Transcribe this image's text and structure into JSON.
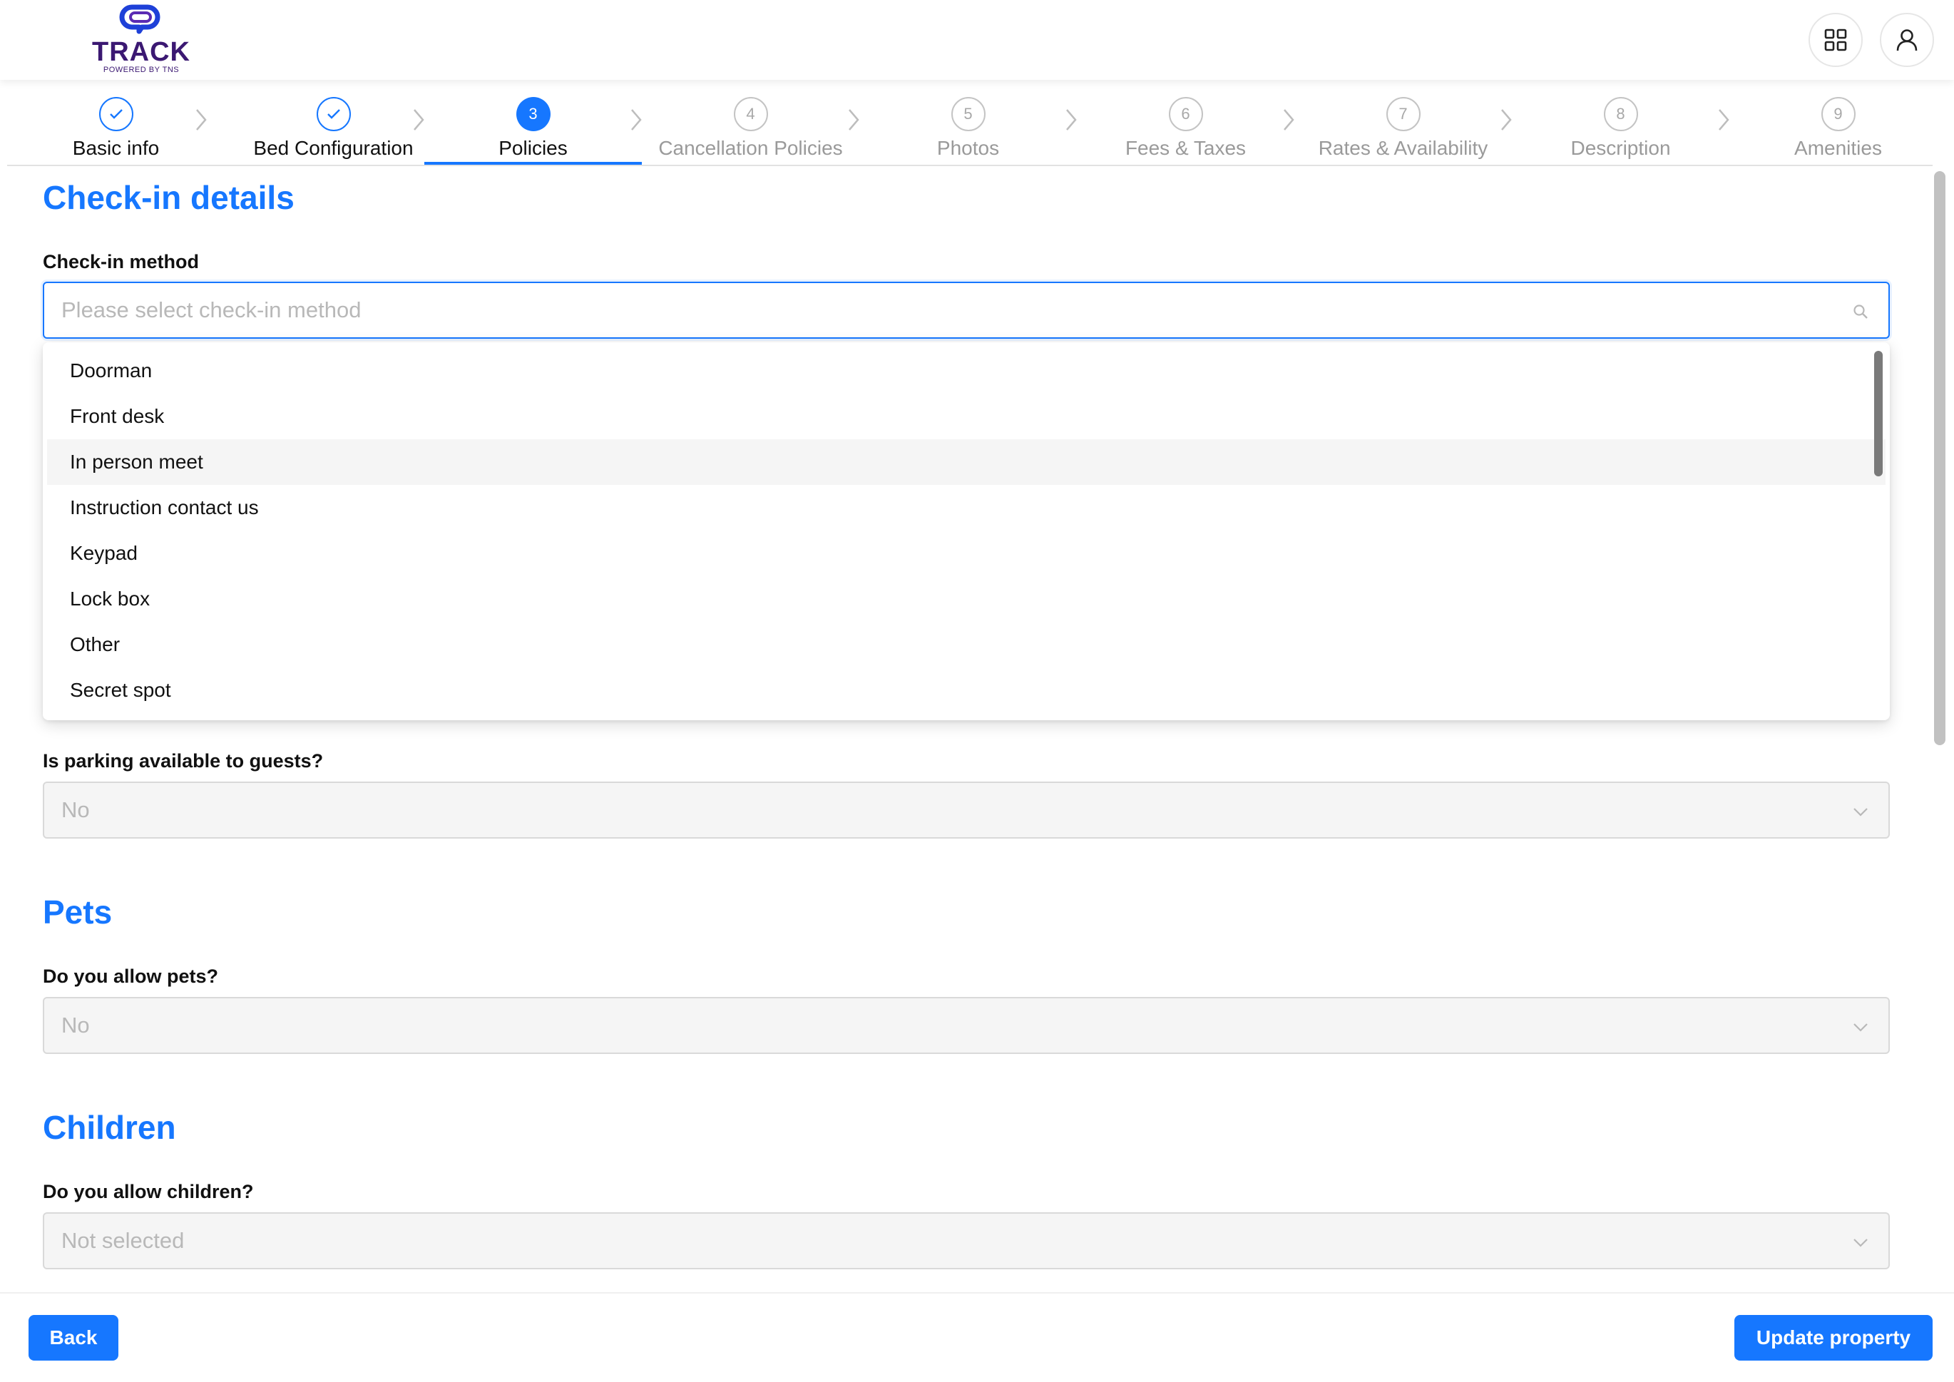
{
  "brand": {
    "name": "TRACK",
    "tagline": "POWERED BY TNS"
  },
  "header": {
    "apps_icon": "grid-icon",
    "user_icon": "user-icon"
  },
  "steps": [
    {
      "label": "Basic info",
      "marker": "",
      "state": "done"
    },
    {
      "label": "Bed Configuration",
      "marker": "",
      "state": "done"
    },
    {
      "label": "Policies",
      "marker": "3",
      "state": "active"
    },
    {
      "label": "Cancellation Policies",
      "marker": "4",
      "state": "todo"
    },
    {
      "label": "Photos",
      "marker": "5",
      "state": "todo"
    },
    {
      "label": "Fees & Taxes",
      "marker": "6",
      "state": "todo"
    },
    {
      "label": "Rates & Availability",
      "marker": "7",
      "state": "todo"
    },
    {
      "label": "Description",
      "marker": "8",
      "state": "todo"
    },
    {
      "label": "Amenities",
      "marker": "9",
      "state": "todo"
    }
  ],
  "checkin": {
    "title": "Check-in details",
    "method_label": "Check-in method",
    "method_placeholder": "Please select check-in method",
    "options": [
      "Doorman",
      "Front desk",
      "In person meet",
      "Instruction contact us",
      "Keypad",
      "Lock box",
      "Other",
      "Secret spot"
    ],
    "highlighted_option": "In person meet",
    "parking_label": "Is parking available to guests?",
    "parking_value": "No"
  },
  "pets": {
    "title": "Pets",
    "label": "Do you allow pets?",
    "value": "No"
  },
  "children": {
    "title": "Children",
    "label": "Do you allow children?",
    "value": "Not selected"
  },
  "footer": {
    "back": "Back",
    "update": "Update property"
  },
  "colors": {
    "primary": "#1677ff",
    "brand": "#3b1872"
  }
}
